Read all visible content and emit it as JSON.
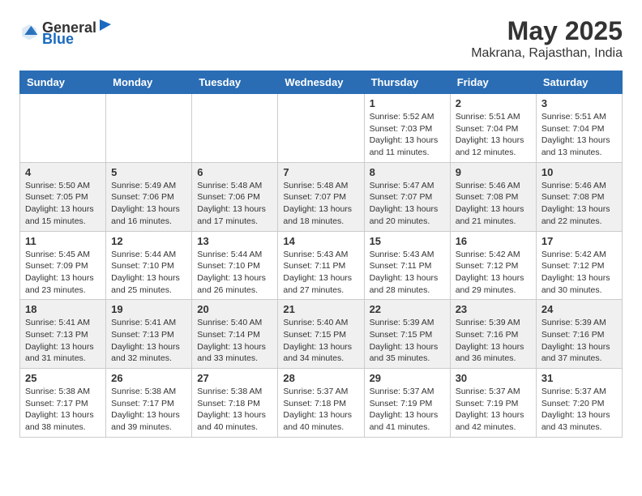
{
  "header": {
    "logo_general": "General",
    "logo_blue": "Blue",
    "month_title": "May 2025",
    "subtitle": "Makrana, Rajasthan, India"
  },
  "days_of_week": [
    "Sunday",
    "Monday",
    "Tuesday",
    "Wednesday",
    "Thursday",
    "Friday",
    "Saturday"
  ],
  "weeks": [
    {
      "row": 1,
      "days": [
        {
          "date": "",
          "info": ""
        },
        {
          "date": "",
          "info": ""
        },
        {
          "date": "",
          "info": ""
        },
        {
          "date": "",
          "info": ""
        },
        {
          "date": "1",
          "info": "Sunrise: 5:52 AM\nSunset: 7:03 PM\nDaylight: 13 hours\nand 11 minutes."
        },
        {
          "date": "2",
          "info": "Sunrise: 5:51 AM\nSunset: 7:04 PM\nDaylight: 13 hours\nand 12 minutes."
        },
        {
          "date": "3",
          "info": "Sunrise: 5:51 AM\nSunset: 7:04 PM\nDaylight: 13 hours\nand 13 minutes."
        }
      ]
    },
    {
      "row": 2,
      "days": [
        {
          "date": "4",
          "info": "Sunrise: 5:50 AM\nSunset: 7:05 PM\nDaylight: 13 hours\nand 15 minutes."
        },
        {
          "date": "5",
          "info": "Sunrise: 5:49 AM\nSunset: 7:06 PM\nDaylight: 13 hours\nand 16 minutes."
        },
        {
          "date": "6",
          "info": "Sunrise: 5:48 AM\nSunset: 7:06 PM\nDaylight: 13 hours\nand 17 minutes."
        },
        {
          "date": "7",
          "info": "Sunrise: 5:48 AM\nSunset: 7:07 PM\nDaylight: 13 hours\nand 18 minutes."
        },
        {
          "date": "8",
          "info": "Sunrise: 5:47 AM\nSunset: 7:07 PM\nDaylight: 13 hours\nand 20 minutes."
        },
        {
          "date": "9",
          "info": "Sunrise: 5:46 AM\nSunset: 7:08 PM\nDaylight: 13 hours\nand 21 minutes."
        },
        {
          "date": "10",
          "info": "Sunrise: 5:46 AM\nSunset: 7:08 PM\nDaylight: 13 hours\nand 22 minutes."
        }
      ]
    },
    {
      "row": 3,
      "days": [
        {
          "date": "11",
          "info": "Sunrise: 5:45 AM\nSunset: 7:09 PM\nDaylight: 13 hours\nand 23 minutes."
        },
        {
          "date": "12",
          "info": "Sunrise: 5:44 AM\nSunset: 7:10 PM\nDaylight: 13 hours\nand 25 minutes."
        },
        {
          "date": "13",
          "info": "Sunrise: 5:44 AM\nSunset: 7:10 PM\nDaylight: 13 hours\nand 26 minutes."
        },
        {
          "date": "14",
          "info": "Sunrise: 5:43 AM\nSunset: 7:11 PM\nDaylight: 13 hours\nand 27 minutes."
        },
        {
          "date": "15",
          "info": "Sunrise: 5:43 AM\nSunset: 7:11 PM\nDaylight: 13 hours\nand 28 minutes."
        },
        {
          "date": "16",
          "info": "Sunrise: 5:42 AM\nSunset: 7:12 PM\nDaylight: 13 hours\nand 29 minutes."
        },
        {
          "date": "17",
          "info": "Sunrise: 5:42 AM\nSunset: 7:12 PM\nDaylight: 13 hours\nand 30 minutes."
        }
      ]
    },
    {
      "row": 4,
      "days": [
        {
          "date": "18",
          "info": "Sunrise: 5:41 AM\nSunset: 7:13 PM\nDaylight: 13 hours\nand 31 minutes."
        },
        {
          "date": "19",
          "info": "Sunrise: 5:41 AM\nSunset: 7:13 PM\nDaylight: 13 hours\nand 32 minutes."
        },
        {
          "date": "20",
          "info": "Sunrise: 5:40 AM\nSunset: 7:14 PM\nDaylight: 13 hours\nand 33 minutes."
        },
        {
          "date": "21",
          "info": "Sunrise: 5:40 AM\nSunset: 7:15 PM\nDaylight: 13 hours\nand 34 minutes."
        },
        {
          "date": "22",
          "info": "Sunrise: 5:39 AM\nSunset: 7:15 PM\nDaylight: 13 hours\nand 35 minutes."
        },
        {
          "date": "23",
          "info": "Sunrise: 5:39 AM\nSunset: 7:16 PM\nDaylight: 13 hours\nand 36 minutes."
        },
        {
          "date": "24",
          "info": "Sunrise: 5:39 AM\nSunset: 7:16 PM\nDaylight: 13 hours\nand 37 minutes."
        }
      ]
    },
    {
      "row": 5,
      "days": [
        {
          "date": "25",
          "info": "Sunrise: 5:38 AM\nSunset: 7:17 PM\nDaylight: 13 hours\nand 38 minutes."
        },
        {
          "date": "26",
          "info": "Sunrise: 5:38 AM\nSunset: 7:17 PM\nDaylight: 13 hours\nand 39 minutes."
        },
        {
          "date": "27",
          "info": "Sunrise: 5:38 AM\nSunset: 7:18 PM\nDaylight: 13 hours\nand 40 minutes."
        },
        {
          "date": "28",
          "info": "Sunrise: 5:37 AM\nSunset: 7:18 PM\nDaylight: 13 hours\nand 40 minutes."
        },
        {
          "date": "29",
          "info": "Sunrise: 5:37 AM\nSunset: 7:19 PM\nDaylight: 13 hours\nand 41 minutes."
        },
        {
          "date": "30",
          "info": "Sunrise: 5:37 AM\nSunset: 7:19 PM\nDaylight: 13 hours\nand 42 minutes."
        },
        {
          "date": "31",
          "info": "Sunrise: 5:37 AM\nSunset: 7:20 PM\nDaylight: 13 hours\nand 43 minutes."
        }
      ]
    }
  ]
}
